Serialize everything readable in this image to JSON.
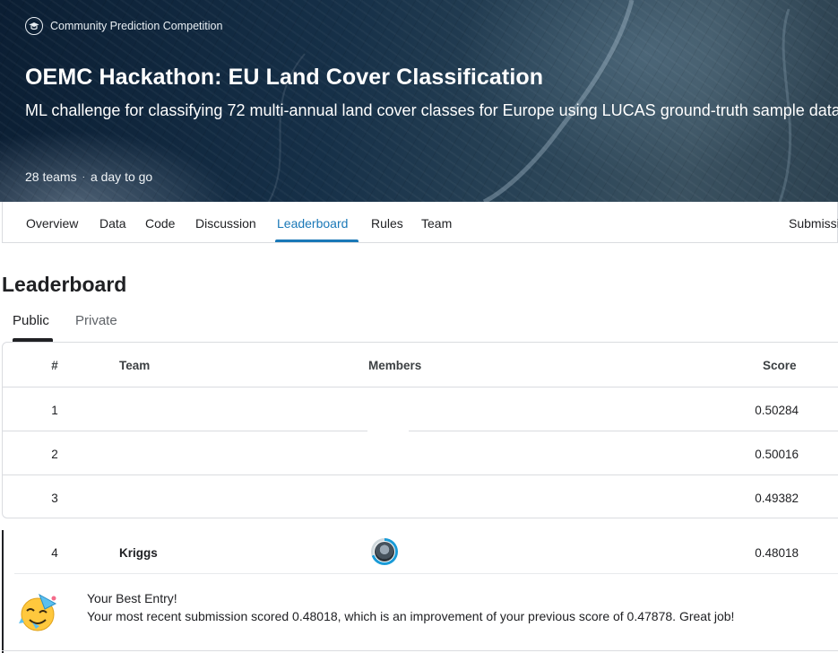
{
  "hero": {
    "category": "Community Prediction Competition",
    "title": "OEMC Hackathon: EU Land Cover Classification",
    "description": "ML challenge for classifying 72 multi-annual land cover classes for Europe using LUCAS ground-truth sample data",
    "teams": "28 teams",
    "deadline": "a day to go",
    "icon": "graduation-cap-icon"
  },
  "nav": {
    "tabs": [
      "Overview",
      "Data",
      "Code",
      "Discussion",
      "Leaderboard",
      "Rules",
      "Team"
    ],
    "active": "Leaderboard",
    "submissions": "Submissions",
    "accent": "#1a78b7"
  },
  "leaderboard": {
    "title": "Leaderboard",
    "subtabs": [
      "Public",
      "Private"
    ],
    "active_subtab": "Public",
    "headers": {
      "rank": "#",
      "team": "Team",
      "members": "Members",
      "score": "Score"
    },
    "rows": [
      {
        "rank": "1",
        "team": "",
        "score": "0.50284"
      },
      {
        "rank": "2",
        "team": "",
        "score": "0.50016"
      },
      {
        "rank": "3",
        "team": "",
        "score": "0.49382"
      }
    ],
    "my_row": {
      "rank": "4",
      "team": "Kriggs",
      "score": "0.48018",
      "avatar": "user-avatar"
    }
  },
  "best_entry": {
    "title": "Your Best Entry!",
    "message": "Your most recent submission scored 0.48018, which is an improvement of your previous score of 0.47878. Great job!",
    "icon": "party-face-icon"
  }
}
